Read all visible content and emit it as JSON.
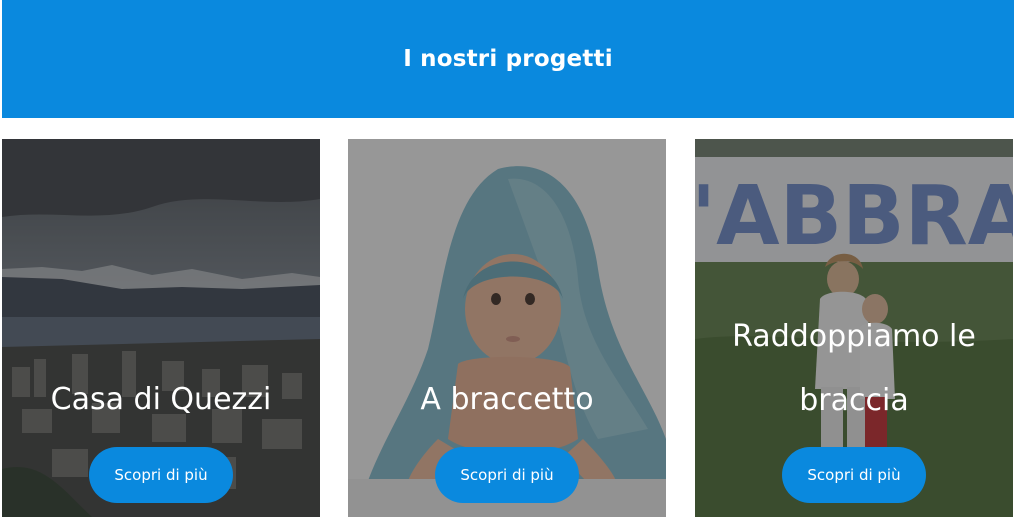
{
  "header": {
    "title": "I nostri progetti"
  },
  "projects": [
    {
      "title": "Casa di Quezzi",
      "button_label": "Scopri di più",
      "image": "city-panorama-image"
    },
    {
      "title": "A braccetto",
      "button_label": "Scopri di più",
      "image": "baby-towel-image"
    },
    {
      "title": "Raddoppiamo le braccia",
      "button_label": "Scopri di più",
      "image": "children-banner-image",
      "banner_text": "'ABBRA"
    }
  ],
  "colors": {
    "accent": "#0a89de",
    "text_on_accent": "#ffffff"
  }
}
